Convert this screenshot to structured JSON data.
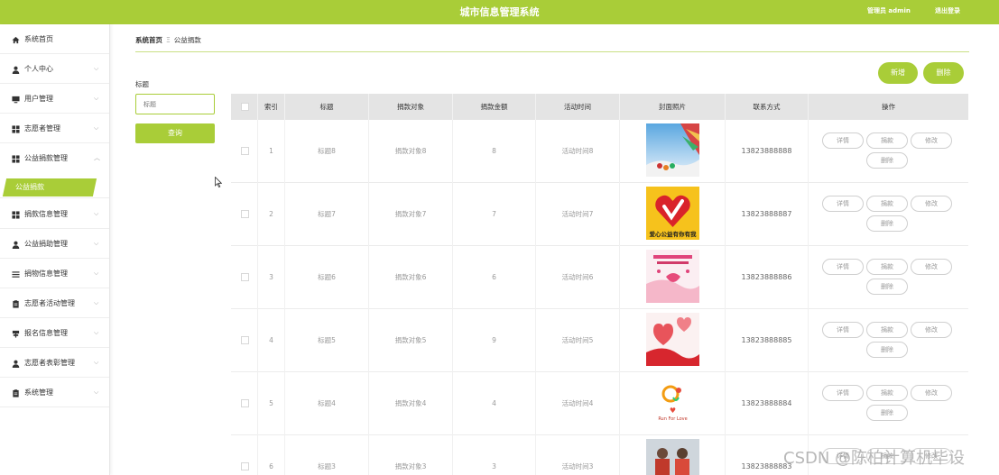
{
  "header": {
    "title": "城市信息管理系统",
    "role_text": "管理员 admin",
    "logout_label": "退出登录"
  },
  "sidebar": {
    "items": [
      {
        "label": "系统首页",
        "icon": "home-icon",
        "chevron": false
      },
      {
        "label": "个人中心",
        "icon": "user-icon",
        "chevron": true
      },
      {
        "label": "用户管理",
        "icon": "monitor-icon",
        "chevron": true
      },
      {
        "label": "志愿者管理",
        "icon": "grid-icon",
        "chevron": true
      },
      {
        "label": "公益捐款管理",
        "icon": "grid-icon",
        "chevron": true,
        "expanded": true
      },
      {
        "label": "捐款信息管理",
        "icon": "grid-icon",
        "chevron": true
      },
      {
        "label": "公益捐助管理",
        "icon": "user-icon",
        "chevron": true
      },
      {
        "label": "捐物信息管理",
        "icon": "list-icon",
        "chevron": true
      },
      {
        "label": "志愿者活动管理",
        "icon": "clipboard-icon",
        "chevron": true
      },
      {
        "label": "报名信息管理",
        "icon": "signpost-icon",
        "chevron": true
      },
      {
        "label": "志愿者表彰管理",
        "icon": "user-icon",
        "chevron": true
      },
      {
        "label": "系统管理",
        "icon": "clipboard-icon",
        "chevron": true
      }
    ],
    "active_sub": "公益捐款"
  },
  "breadcrumb": {
    "home": "系统首页",
    "separator": "Ξ",
    "current": "公益捐款"
  },
  "search": {
    "label": "标题",
    "placeholder": "标题",
    "button_label": "查询"
  },
  "actions": {
    "add_label": "新增",
    "delete_label": "删除"
  },
  "table": {
    "columns": [
      "索引",
      "标题",
      "捐款对象",
      "捐款金额",
      "活动时间",
      "封面照片",
      "联系方式",
      "操作"
    ],
    "rows": [
      {
        "index": "1",
        "title": "标题8",
        "target": "捐款对象8",
        "amount": "8",
        "time": "活动时间8",
        "phone": "13823888888"
      },
      {
        "index": "2",
        "title": "标题7",
        "target": "捐款对象7",
        "amount": "7",
        "time": "活动时间7",
        "phone": "13823888887"
      },
      {
        "index": "3",
        "title": "标题6",
        "target": "捐款对象6",
        "amount": "6",
        "time": "活动时间6",
        "phone": "13823888886"
      },
      {
        "index": "4",
        "title": "标题5",
        "target": "捐款对象5",
        "amount": "9",
        "time": "活动时间5",
        "phone": "13823888885"
      },
      {
        "index": "5",
        "title": "标题4",
        "target": "捐款对象4",
        "amount": "4",
        "time": "活动时间4",
        "phone": "13823888884"
      },
      {
        "index": "6",
        "title": "标题3",
        "target": "捐款对象3",
        "amount": "3",
        "time": "活动时间3",
        "phone": "13823888883"
      }
    ],
    "row_actions": {
      "detail": "详情",
      "donate": "捐款",
      "edit": "修改",
      "delete": "删除"
    }
  },
  "image_captions": {
    "thumb2_caption": "爱心公益有你有我",
    "thumb5_logo_text": "Run For Love"
  },
  "watermark": "CSDN @陈柏计算机毕设",
  "colors": {
    "accent": "#a9cd38",
    "header_bg": "#a9cd38",
    "table_header_bg": "#e4e4e4"
  }
}
